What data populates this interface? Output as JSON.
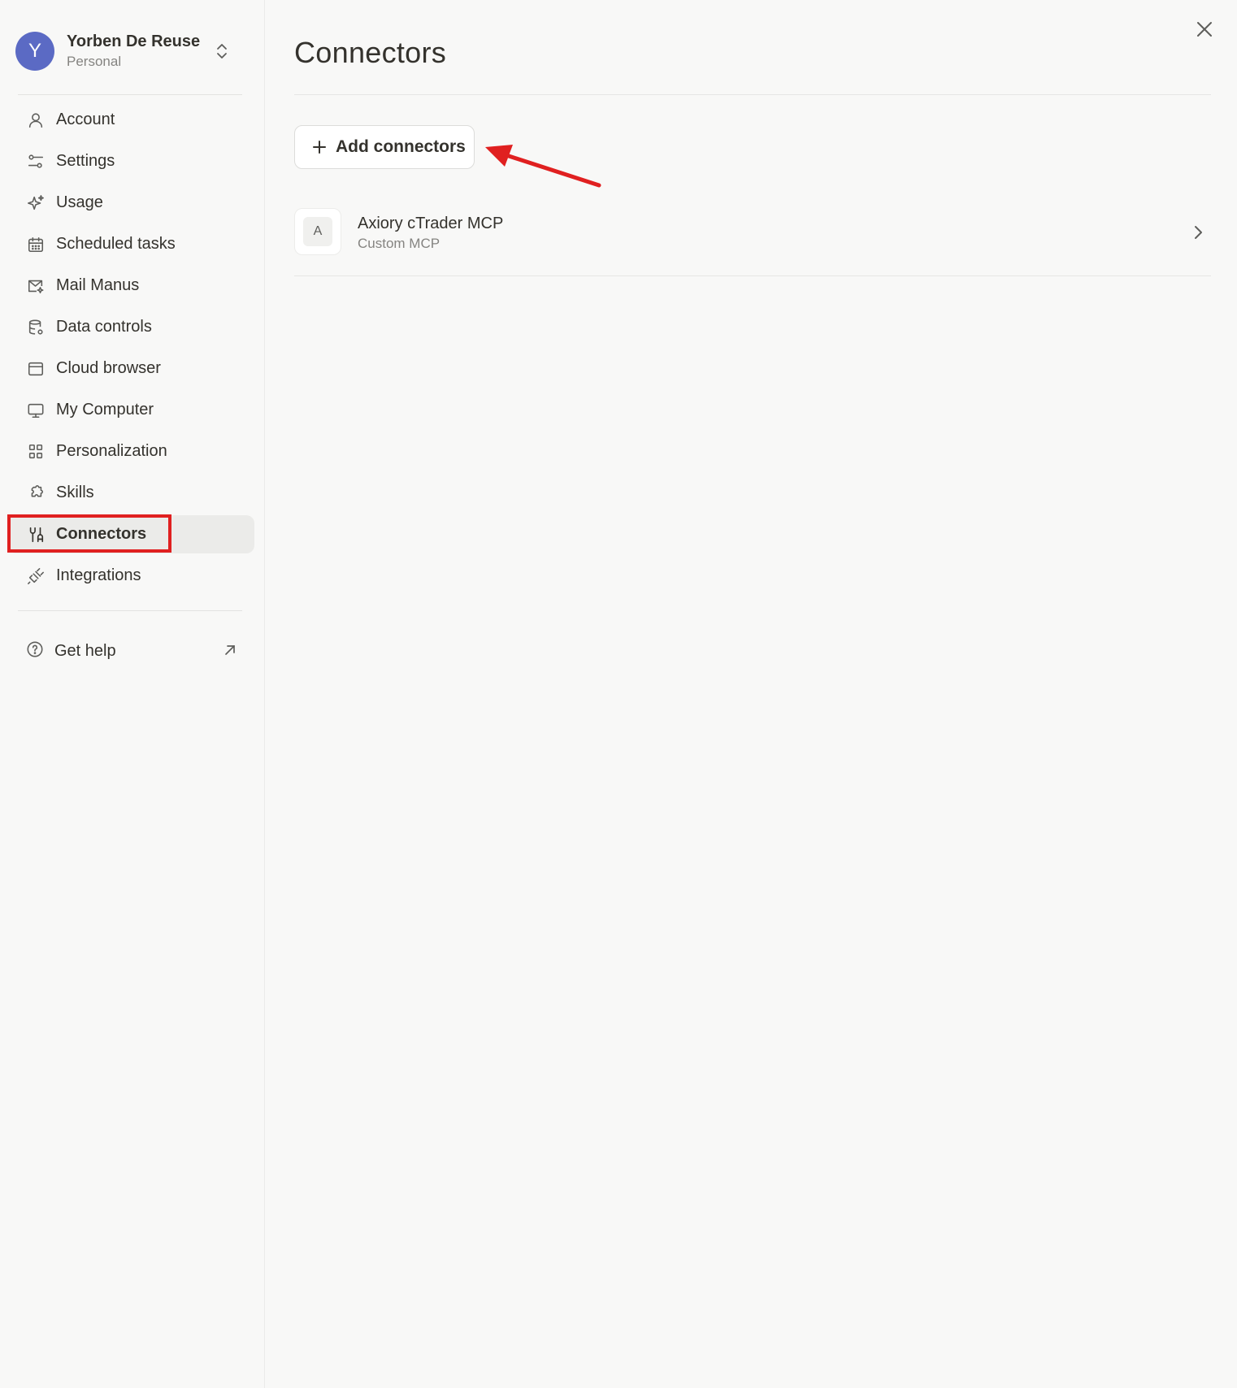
{
  "profile": {
    "avatar_letter": "Y",
    "name": "Yorben De Reuse",
    "plan": "Personal"
  },
  "sidebar": {
    "items": [
      {
        "label": "Account",
        "icon": "user-icon"
      },
      {
        "label": "Settings",
        "icon": "sliders-icon"
      },
      {
        "label": "Usage",
        "icon": "sparkle-icon"
      },
      {
        "label": "Scheduled tasks",
        "icon": "calendar-icon"
      },
      {
        "label": "Mail Manus",
        "icon": "mail-icon"
      },
      {
        "label": "Data controls",
        "icon": "database-icon"
      },
      {
        "label": "Cloud browser",
        "icon": "browser-window-icon"
      },
      {
        "label": "My Computer",
        "icon": "monitor-icon"
      },
      {
        "label": "Personalization",
        "icon": "shapes-icon"
      },
      {
        "label": "Skills",
        "icon": "puzzle-icon"
      },
      {
        "label": "Connectors",
        "icon": "connectors-icon",
        "active": true
      },
      {
        "label": "Integrations",
        "icon": "plug-icon"
      }
    ],
    "help": {
      "label": "Get help",
      "icon": "help-circle-icon"
    }
  },
  "main": {
    "title": "Connectors",
    "add_button_label": "Add connectors",
    "connectors": [
      {
        "logo_letter": "A",
        "name": "Axiory cTrader MCP",
        "type": "Custom MCP"
      }
    ]
  },
  "colors": {
    "avatar": "#5b6ac4",
    "annotation": "#e02020",
    "active_bg": "#ebebe9",
    "background": "#f8f8f7"
  }
}
